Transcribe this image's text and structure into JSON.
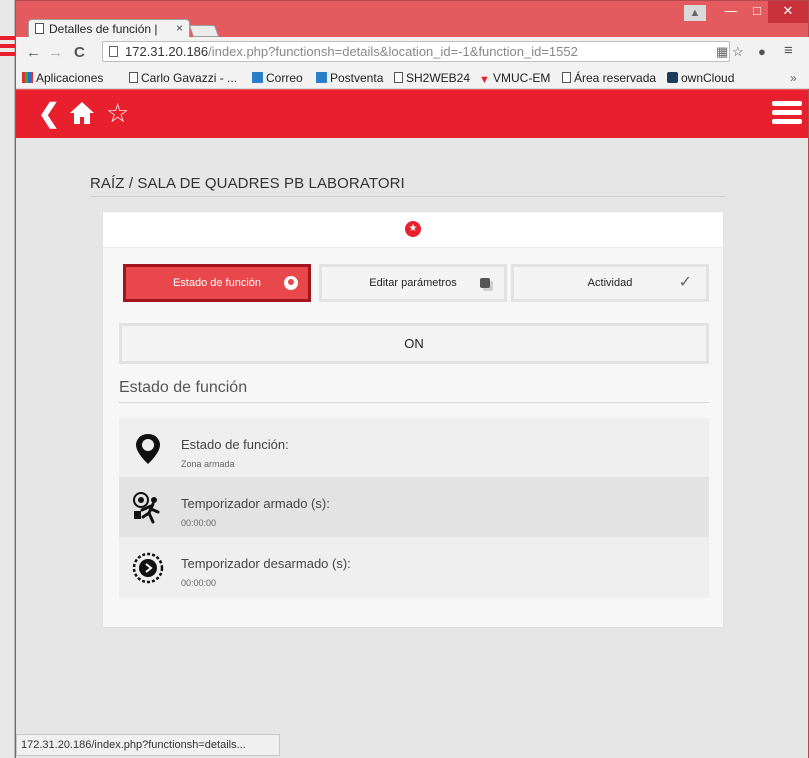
{
  "browser": {
    "tab_title": "Detalles de función |",
    "tab_close": "×",
    "url_host": "172.31.20.186",
    "url_path": "/index.php?functionsh=details&location_id=-1&function_id=1552",
    "window_controls": {
      "minimize": "—",
      "maximize": "□",
      "close": "✕"
    },
    "bookmarks": [
      {
        "label": "Aplicaciones",
        "icon": "apps-grid-icon"
      },
      {
        "label": "Carlo Gavazzi - ...",
        "icon": "page-icon"
      },
      {
        "label": "Correo",
        "icon": "mail-app-icon"
      },
      {
        "label": "Postventa",
        "icon": "postventa-app-icon"
      },
      {
        "label": "SH2WEB24",
        "icon": "page-icon"
      },
      {
        "label": "VMUC-EM",
        "icon": "vmuc-icon"
      },
      {
        "label": "Área reservada",
        "icon": "page-icon"
      },
      {
        "label": "ownCloud",
        "icon": "owncloud-icon"
      }
    ],
    "bookmarks_more": "»",
    "status_url": "172.31.20.186/index.php?functionsh=details..."
  },
  "app": {
    "accent_color": "#e8202e",
    "breadcrumb": "RAÍZ / SALA DE QUADRES PB LABORATORI",
    "tabs": [
      {
        "label": "Estado de función",
        "active": true,
        "icon": "location-pin-icon"
      },
      {
        "label": "Editar parámetros",
        "active": false,
        "icon": "edit-square-icon"
      },
      {
        "label": "Actividad",
        "active": false,
        "icon": "checkmark-icon"
      }
    ],
    "state_button": "ON",
    "section_title": "Estado de función",
    "rows": [
      {
        "label": "Estado de función:",
        "value": "Zona armada",
        "icon": "location-pin-icon"
      },
      {
        "label": "Temporizador armado (s):",
        "value": "00:00:00",
        "icon": "armed-timer-icon"
      },
      {
        "label": "Temporizador desarmado (s):",
        "value": "00:00:00",
        "icon": "disarmed-timer-icon"
      }
    ]
  }
}
